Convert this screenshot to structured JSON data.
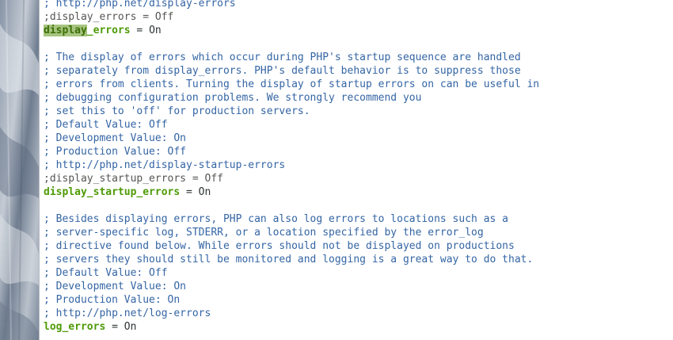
{
  "editor": {
    "language": "ini",
    "syntax_colors": {
      "comment": "#3465a4",
      "commented_setting": "#555753",
      "key": "#4e9a06",
      "value": "#2e3436",
      "search_highlight": "#a6c47f"
    },
    "lines": [
      {
        "kind": "comment",
        "text": "; http://php.net/display-errors"
      },
      {
        "kind": "dim",
        "text": ";display_errors = Off"
      },
      {
        "kind": "setting",
        "key_highlight": "display",
        "key_rest": "_errors",
        "sep": " = ",
        "value": "On"
      },
      {
        "kind": "blank",
        "text": ""
      },
      {
        "kind": "comment",
        "text": "; The display of errors which occur during PHP's startup sequence are handled"
      },
      {
        "kind": "comment",
        "text": "; separately from display_errors. PHP's default behavior is to suppress those"
      },
      {
        "kind": "comment",
        "text": "; errors from clients. Turning the display of startup errors on can be useful in"
      },
      {
        "kind": "comment",
        "text": "; debugging configuration problems. We strongly recommend you"
      },
      {
        "kind": "comment",
        "text": "; set this to 'off' for production servers."
      },
      {
        "kind": "comment",
        "text": "; Default Value: Off"
      },
      {
        "kind": "comment",
        "text": "; Development Value: On"
      },
      {
        "kind": "comment",
        "text": "; Production Value: Off"
      },
      {
        "kind": "comment",
        "text": "; http://php.net/display-startup-errors"
      },
      {
        "kind": "dim",
        "text": ";display_startup_errors = Off"
      },
      {
        "kind": "setting",
        "key": "display_startup_errors",
        "sep": " = ",
        "value": "On"
      },
      {
        "kind": "blank",
        "text": ""
      },
      {
        "kind": "comment",
        "text": "; Besides displaying errors, PHP can also log errors to locations such as a"
      },
      {
        "kind": "comment",
        "text": "; server-specific log, STDERR, or a location specified by the error_log"
      },
      {
        "kind": "comment",
        "text": "; directive found below. While errors should not be displayed on productions"
      },
      {
        "kind": "comment",
        "text": "; servers they should still be monitored and logging is a great way to do that."
      },
      {
        "kind": "comment",
        "text": "; Default Value: Off"
      },
      {
        "kind": "comment",
        "text": "; Development Value: On"
      },
      {
        "kind": "comment",
        "text": "; Production Value: On"
      },
      {
        "kind": "comment",
        "text": "; http://php.net/log-errors"
      },
      {
        "kind": "setting",
        "key": "log_errors",
        "sep": " = ",
        "value": "On"
      }
    ]
  }
}
